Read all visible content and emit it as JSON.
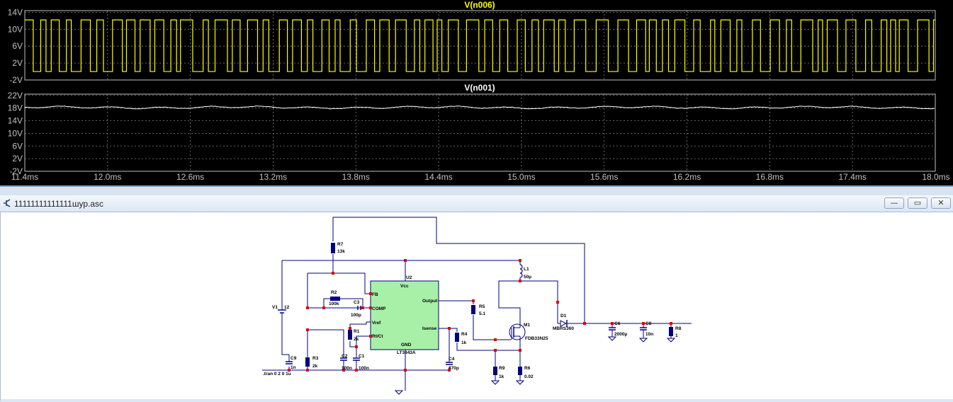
{
  "waveform_viewer": {
    "pane_top": {
      "trace": "V(n006)",
      "trace_color": "#ffff00",
      "y_ticks": [
        "14V",
        "10V",
        "6V",
        "2V",
        "-2V"
      ],
      "y_values": [
        14,
        10,
        6,
        2,
        -2
      ],
      "high_level": 12.2,
      "low_level": 0
    },
    "pane_bottom": {
      "trace": "V(n001)",
      "trace_color": "#ffffff",
      "y_ticks": [
        "22V",
        "18V",
        "14V",
        "10V",
        "6V",
        "2V",
        "-2V"
      ],
      "y_values": [
        22,
        18,
        14,
        10,
        6,
        2,
        -2
      ],
      "mean_level": 18.2
    },
    "x_ticks": [
      "11.4ms",
      "12.0ms",
      "12.6ms",
      "13.2ms",
      "13.8ms",
      "14.4ms",
      "15.0ms",
      "15.6ms",
      "16.2ms",
      "16.8ms",
      "17.4ms",
      "18.0ms"
    ],
    "x_values": [
      11.4,
      12.0,
      12.6,
      13.2,
      13.8,
      14.4,
      15.0,
      15.6,
      16.2,
      16.8,
      17.4,
      18.0
    ],
    "grid_color": "#808080",
    "grid": "dashed"
  },
  "schematic_window": {
    "title": "11111111111111шур.asc",
    "buttons": {
      "minimize": "—",
      "restore": "▭",
      "close": "✕"
    },
    "components": {
      "R7": {
        "name": "R7",
        "value": "13k"
      },
      "R2": {
        "name": "R2",
        "value": "100k"
      },
      "C3": {
        "name": "C3",
        "value": "100p"
      },
      "R1": {
        "name": "R1",
        "value": "2k"
      },
      "V1": {
        "name": "V1",
        "value": "12"
      },
      "C9": {
        "name": "C9",
        "value": "1n"
      },
      "R3": {
        "name": "R3",
        "value": "2k"
      },
      "C2": {
        "name": "C2",
        "value": "100n"
      },
      "C1": {
        "name": "C1",
        "value": "100n"
      },
      "U2": {
        "name": "U2",
        "part": "LT3843A"
      },
      "C4": {
        "name": "C4",
        "value": "470p"
      },
      "R5": {
        "name": "R5",
        "value": "5.1"
      },
      "R4": {
        "name": "R4",
        "value": "1k"
      },
      "L1": {
        "name": "L1",
        "value": "50µ"
      },
      "M1": {
        "name": "M1",
        "part": "FDB33N25"
      },
      "R9": {
        "name": "R9",
        "value": "1k"
      },
      "R6": {
        "name": "R6",
        "value": "0.02"
      },
      "D1": {
        "name": "D1",
        "part": "MBRS360"
      },
      "C6": {
        "name": "C6",
        "value": "2000µ"
      },
      "C8": {
        "name": "C8",
        "value": "10n"
      },
      "R8": {
        "name": "R8",
        "value": "1"
      }
    },
    "pins": {
      "fb": "FB",
      "comp": "COMP",
      "vref": "Vref",
      "rtct": "Rt/Ct",
      "vcc": "Vcc",
      "gnd": "GND",
      "output": "Output",
      "isense": "Isense"
    },
    "directive": ".tran 0 2 0 1u",
    "colors": {
      "wire": "#000080",
      "ic_fill": "#a8f0a8",
      "junction": "#e00000",
      "component": "#000080"
    }
  }
}
